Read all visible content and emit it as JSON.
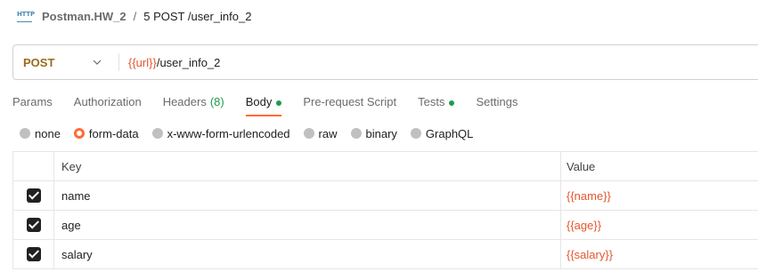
{
  "breadcrumb": {
    "icon_text": "HTTP",
    "collection": "Postman.HW_2",
    "separator": "/",
    "request": "5 POST /user_info_2"
  },
  "url_bar": {
    "method": "POST",
    "url_variable": "{{url}}",
    "url_path": "/user_info_2"
  },
  "tabs": [
    {
      "label": "Params"
    },
    {
      "label": "Authorization"
    },
    {
      "label": "Headers",
      "count": "(8)"
    },
    {
      "label": "Body",
      "active": true,
      "indicator": "green-dot"
    },
    {
      "label": "Pre-request Script"
    },
    {
      "label": "Tests",
      "indicator": "green-dot"
    },
    {
      "label": "Settings"
    }
  ],
  "body_types": [
    {
      "label": "none",
      "selected": false
    },
    {
      "label": "form-data",
      "selected": true
    },
    {
      "label": "x-www-form-urlencoded",
      "selected": false
    },
    {
      "label": "raw",
      "selected": false
    },
    {
      "label": "binary",
      "selected": false
    },
    {
      "label": "GraphQL",
      "selected": false
    }
  ],
  "table": {
    "headers": {
      "key": "Key",
      "value": "Value"
    },
    "rows": [
      {
        "checked": true,
        "key": "name",
        "value": "{{name}}"
      },
      {
        "checked": true,
        "key": "age",
        "value": "{{age}}"
      },
      {
        "checked": true,
        "key": "salary",
        "value": "{{salary}}"
      }
    ]
  },
  "colors": {
    "accent": "#ff6c37",
    "variable": "#e4572e",
    "method_post": "#9a6b1a",
    "indicator": "#1d9c4a"
  }
}
